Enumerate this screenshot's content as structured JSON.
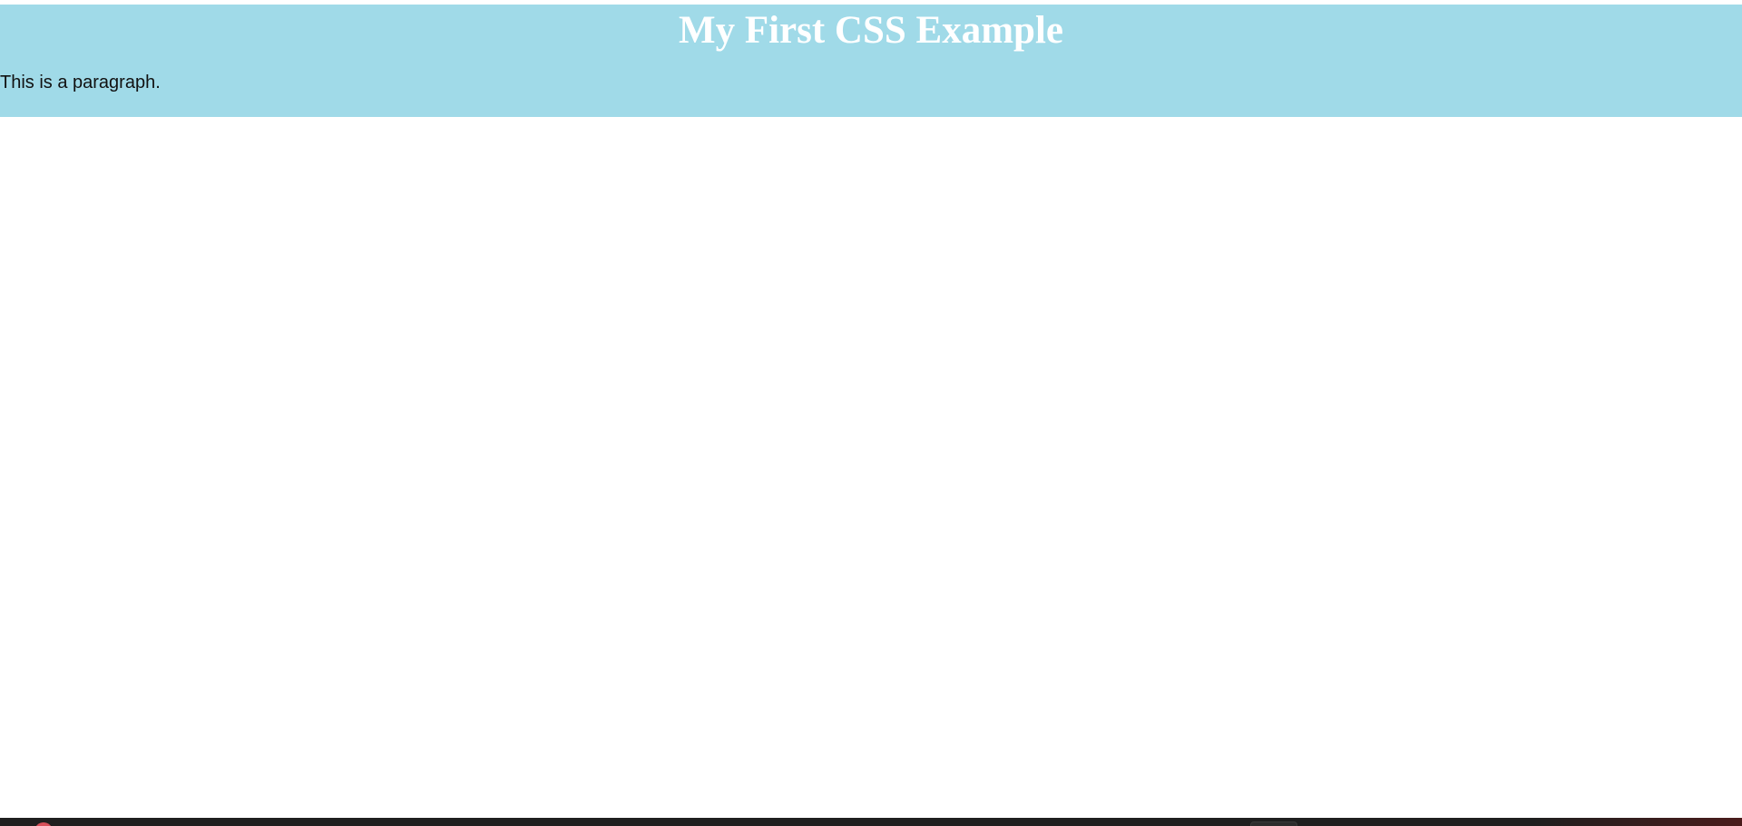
{
  "heading": {
    "text": "My First CSS Example"
  },
  "paragraph": {
    "text": "This is a paragraph."
  },
  "colors": {
    "banner_background": "#a0dae8",
    "heading_text": "#ffffff",
    "paragraph_text": "#111111",
    "taskbar": "#1f1f1f"
  },
  "taskbar": {
    "start_icon": "app-icon",
    "tray_icon": "tray-button-icon"
  }
}
